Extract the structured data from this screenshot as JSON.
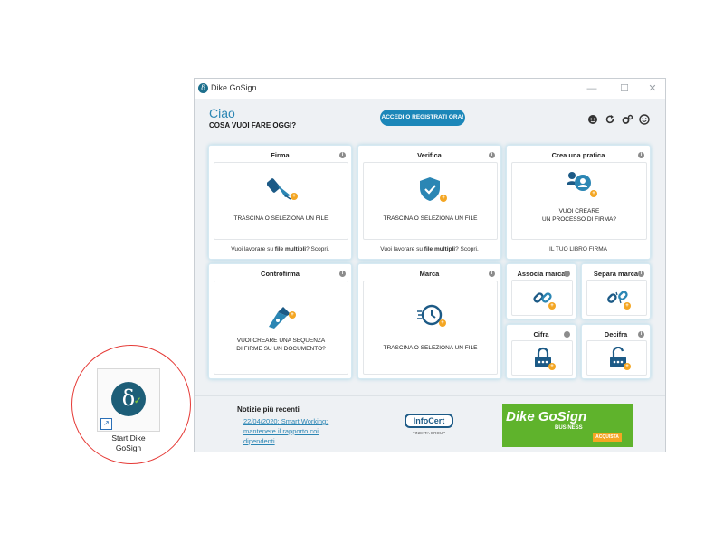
{
  "window": {
    "title": "Dike GoSign",
    "app_logo": "δ",
    "controls": {
      "minimize": "—",
      "maximize": "☐",
      "close": "✕"
    }
  },
  "header": {
    "greeting": "Ciao",
    "question": "COSA VUOI FARE OGGI?",
    "login_button": "ACCEDI O REGISTRATI ORA!",
    "icons": [
      "user-support-icon",
      "refresh-icon",
      "settings-icon",
      "profile-icon"
    ]
  },
  "cards": {
    "firma": {
      "title": "Firma",
      "drop_text": "TRASCINA O SELEZIONA UN FILE",
      "link_pre": "Vuoi lavorare su ",
      "link_bold": "file multipli",
      "link_post": "? Scopri."
    },
    "verifica": {
      "title": "Verifica",
      "drop_text": "TRASCINA O SELEZIONA UN FILE",
      "link_pre": "Vuoi lavorare su ",
      "link_bold": "file multipli",
      "link_post": "? Scopri."
    },
    "crea_pratica": {
      "title": "Crea una pratica",
      "drop_line1": "VUOI CREARE",
      "drop_line2": "UN PROCESSO DI FIRMA?",
      "link": "IL TUO LIBRO FIRMA"
    },
    "controfirma": {
      "title": "Controfirma",
      "drop_line1": "VUOI CREARE UNA SEQUENZA",
      "drop_line2": "DI FIRME SU UN DOCUMENTO?"
    },
    "marca": {
      "title": "Marca",
      "drop_text": "TRASCINA O SELEZIONA UN FILE"
    },
    "associa_marca": {
      "title": "Associa marca"
    },
    "separa_marca": {
      "title": "Separa marca"
    },
    "cifra": {
      "title": "Cifra"
    },
    "decifra": {
      "title": "Decifra"
    }
  },
  "info_symbol": "i",
  "news": {
    "title": "Notizie più recenti",
    "date": "22/04/2020",
    "text": ": Smart Working: mantenere il rapporto coi dipendenti"
  },
  "partner": {
    "logo_text": "InfoCert",
    "group": "TINEXTA GROUP"
  },
  "banner": {
    "title": "Dike GoSign",
    "subtitle": "BUSINESS",
    "button": "ACQUISTA"
  },
  "desktop_shortcut": {
    "line1": "Start Dike",
    "line2": "GoSign"
  },
  "colors": {
    "accent": "#1c87b9",
    "title_blue": "#2b86b4",
    "highlight_circle": "#e53935",
    "badge": "#f4a623",
    "banner_green": "#5fb32c"
  }
}
